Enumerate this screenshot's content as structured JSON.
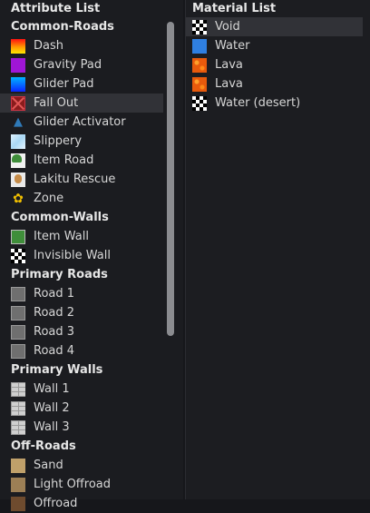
{
  "attribute_list": {
    "title": "Attribute List",
    "groups": [
      {
        "label": "Common-Roads",
        "items": [
          {
            "label": "Dash",
            "icon": "dash-gradient-icon"
          },
          {
            "label": "Gravity Pad",
            "icon": "gravity-pad-icon"
          },
          {
            "label": "Glider Pad",
            "icon": "glider-pad-icon"
          },
          {
            "label": "Fall Out",
            "icon": "fall-out-icon",
            "selected": true
          },
          {
            "label": "Glider Activator",
            "icon": "glider-activator-icon"
          },
          {
            "label": "Slippery",
            "icon": "slippery-icon"
          },
          {
            "label": "Item Road",
            "icon": "item-road-icon"
          },
          {
            "label": "Lakitu Rescue",
            "icon": "lakitu-icon"
          },
          {
            "label": "Zone",
            "icon": "zone-icon"
          }
        ]
      },
      {
        "label": "Common-Walls",
        "items": [
          {
            "label": "Item Wall",
            "icon": "item-wall-icon"
          },
          {
            "label": "Invisible Wall",
            "icon": "checker-icon"
          }
        ]
      },
      {
        "label": "Primary Roads",
        "items": [
          {
            "label": "Road 1",
            "icon": "road-icon"
          },
          {
            "label": "Road 2",
            "icon": "road-icon"
          },
          {
            "label": "Road 3",
            "icon": "road-icon"
          },
          {
            "label": "Road 4",
            "icon": "road-icon"
          }
        ]
      },
      {
        "label": "Primary Walls",
        "items": [
          {
            "label": "Wall 1",
            "icon": "brick-wall-icon"
          },
          {
            "label": "Wall 2",
            "icon": "brick-wall-icon"
          },
          {
            "label": "Wall 3",
            "icon": "brick-wall-icon"
          }
        ]
      },
      {
        "label": "Off-Roads",
        "items": [
          {
            "label": "Sand",
            "icon": "sand-icon"
          },
          {
            "label": "Light Offroad",
            "icon": "light-offroad-icon"
          },
          {
            "label": "Offroad",
            "icon": "offroad-icon"
          }
        ]
      }
    ]
  },
  "material_list": {
    "title": "Material List",
    "items": [
      {
        "label": "Void",
        "icon": "checker-icon",
        "selected": true
      },
      {
        "label": "Water",
        "icon": "water-icon"
      },
      {
        "label": "Lava",
        "icon": "lava-icon"
      },
      {
        "label": "Lava",
        "icon": "lava-icon"
      },
      {
        "label": "Water (desert)",
        "icon": "checker-icon"
      }
    ]
  },
  "colors": {
    "background": "#1b1c20",
    "selection": "#313237",
    "scrollbar": "#8b8c90"
  }
}
